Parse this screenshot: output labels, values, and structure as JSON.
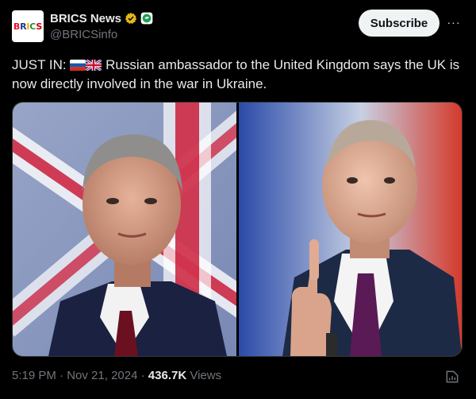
{
  "account": {
    "display_name": "BRICS News",
    "handle": "@BRICSinfo",
    "avatar_letters": [
      "B",
      "R",
      "I",
      "C",
      "S"
    ]
  },
  "actions": {
    "subscribe_label": "Subscribe",
    "more_label": "···"
  },
  "tweet": {
    "prefix": "JUST IN: ",
    "flags": [
      "russia-flag",
      "uk-flag"
    ],
    "body": " Russian ambassador to the United Kingdom says the UK is now directly involved in the war in Ukraine."
  },
  "meta": {
    "time": "5:19 PM",
    "separator": " · ",
    "date": "Nov 21, 2024",
    "views_count": "436.7K",
    "views_label": " Views"
  },
  "colors": {
    "background": "#000000",
    "text_primary": "#e7e9ea",
    "text_secondary": "#71767b",
    "verified_gold": "#e2b719",
    "subscribe_bg": "#eff3f4"
  },
  "icons": {
    "verified": "verified-badge-icon",
    "affiliate": "affiliate-badge-icon",
    "more": "more-dots-icon",
    "analytics": "analytics-icon"
  }
}
